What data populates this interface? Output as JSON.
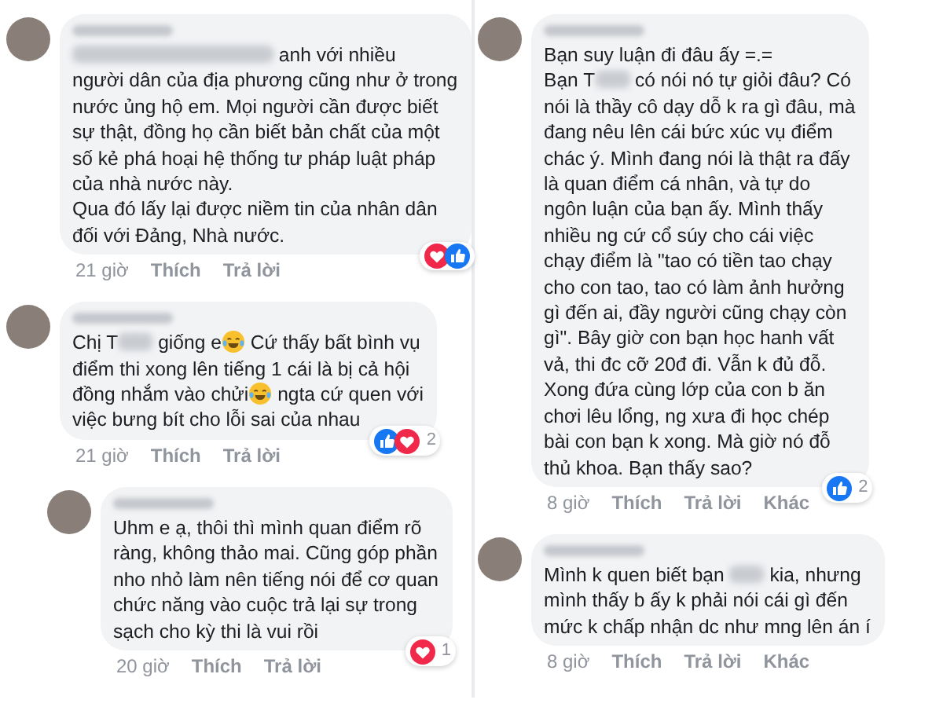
{
  "columns": [
    {
      "comments": [
        {
          "kind": "comment",
          "lines": [
            [
              {
                "kind": "blur_long"
              },
              {
                "kind": "text",
                "text": " anh  với nhiều"
              }
            ],
            "người dân của địa phương cũng như ở trong",
            "nước ủng hộ em. Mọi người cần được biết",
            "sự thật, đồng họ cần biết bản chất của một",
            "số kẻ phá hoại hệ thống tư pháp luật pháp",
            "của nhà nước này.",
            "Qua đó lấy lại được niềm tin của nhân dân",
            "đối với Đảng, Nhà nước."
          ],
          "time": "21 giờ",
          "actions": [
            "Thích",
            "Trả lời"
          ],
          "reactions": [
            {
              "kind": "love"
            },
            {
              "kind": "like"
            }
          ]
        },
        {
          "kind": "comment",
          "lines": [
            [
              {
                "kind": "text",
                "text": "Chị T"
              },
              {
                "kind": "blur"
              },
              {
                "kind": "text",
                "text": " giống e"
              },
              {
                "kind": "emoji"
              },
              {
                "kind": "text",
                "text": " Cứ thấy bất bình vụ"
              }
            ],
            "điểm thi xong lên tiếng 1 cái là bị cả hội",
            [
              {
                "kind": "text",
                "text": "đồng nhắm vào chửi"
              },
              {
                "kind": "emoji"
              },
              {
                "kind": "text",
                "text": " ngta cứ quen với"
              }
            ],
            "việc bưng bít cho lỗi sai của nhau"
          ],
          "time": "21 giờ",
          "actions": [
            "Thích",
            "Trả lời"
          ],
          "reactions": [
            {
              "kind": "like"
            },
            {
              "kind": "love"
            }
          ],
          "reaction_count": "2"
        },
        {
          "kind": "reply",
          "lines": [
            "Uhm e ạ, thôi thì mình quan điểm rõ",
            "ràng, không thảo mai. Cũng góp phần",
            "nho nhỏ làm nên tiếng nói để cơ quan",
            "chức năng vào cuộc trả lại sự trong",
            "sạch cho kỳ thi là vui rồi"
          ],
          "time": "20 giờ",
          "actions": [
            "Thích",
            "Trả lời"
          ],
          "reactions": [
            {
              "kind": "love"
            }
          ],
          "reaction_count": "1"
        }
      ]
    },
    {
      "comments": [
        {
          "kind": "comment",
          "lines": [
            "Bạn suy luận đi đâu ấy =.=",
            [
              {
                "kind": "text",
                "text": "Bạn T"
              },
              {
                "kind": "blur"
              },
              {
                "kind": "text",
                "text": " có nói nó tự giỏi đâu? Có"
              }
            ],
            "nói là thầy cô dạy dỗ k ra gì đâu, mà",
            "đang nêu lên cái bức xúc vụ điểm",
            "chác ý. Mình đang nói là thật ra đấy",
            "là quan điểm cá nhân, và tự do",
            "ngôn luận của bạn ấy. Mình thấy",
            "nhiều ng cứ cổ súy cho cái việc",
            "chạy điểm là \"tao có tiền tao chạy",
            "cho con tao, tao có làm ảnh hưởng",
            "gì đến ai, đầy người cũng chạy còn",
            "gì\". Bây giờ con bạn học hanh vất",
            "vả, thi đc cỡ 20đ đi. Vẫn k đủ đỗ.",
            "Xong đứa cùng lớp của con b ăn",
            "chơi lêu lổng, ng xưa đi học chép",
            "bài con bạn k xong. Mà giờ nó đỗ",
            "thủ khoa. Bạn thấy sao?"
          ],
          "time": "8 giờ",
          "actions": [
            "Thích",
            "Trả lời",
            "Khác"
          ],
          "reactions": [
            {
              "kind": "like"
            }
          ],
          "reaction_count": "2"
        },
        {
          "kind": "comment",
          "lines": [
            [
              {
                "kind": "text",
                "text": "Mình k quen biết bạn "
              },
              {
                "kind": "blur"
              },
              {
                "kind": "text",
                "text": " kia, nhưng"
              }
            ],
            "mình thấy b ấy k phải nói cái gì đến",
            "mức k chấp nhận dc như mng lên án í"
          ],
          "time": "8 giờ",
          "actions": [
            "Thích",
            "Trả lời",
            "Khác"
          ]
        }
      ]
    }
  ]
}
